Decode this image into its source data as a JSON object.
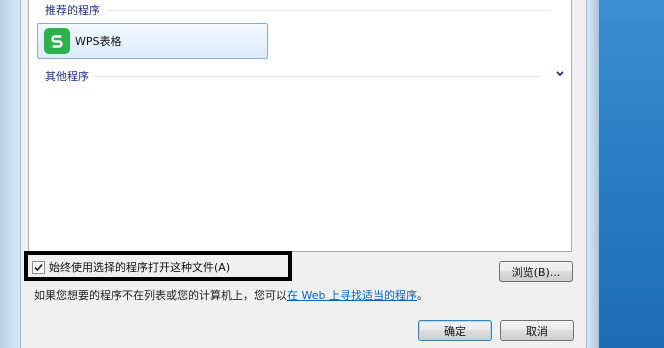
{
  "dialog": {
    "recommended_header": "推荐的程序",
    "other_header": "其他程序",
    "programs": [
      {
        "label": "WPS表格",
        "icon": "wps-spreadsheet-icon",
        "icon_color": "#2bb24c"
      }
    ],
    "always_use_label": "始终使用选择的程序打开这种文件(A)",
    "always_use_checked": true,
    "browse_button": "浏览(B)...",
    "info_text": "如果您想要的程序不在列表或您的计算机上，您可以",
    "info_link": "在 Web 上寻找适当的程序",
    "info_suffix": "。",
    "ok_button": "确定",
    "cancel_button": "取消"
  },
  "colors": {
    "group_header": "#1e3287",
    "link": "#0066cc",
    "highlight_border": "#000000",
    "desktop": "#2a7fc4"
  }
}
